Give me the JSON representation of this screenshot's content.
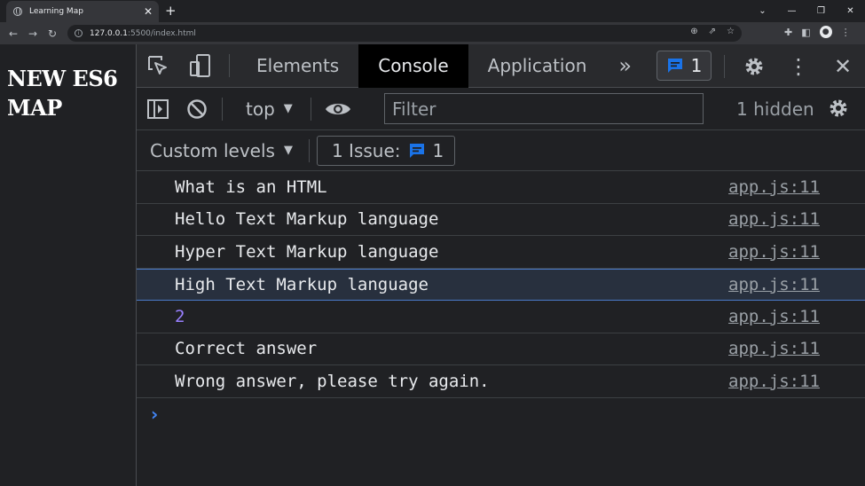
{
  "browser": {
    "tab_title": "Learning Map",
    "new_tab": "+",
    "url_host": "127.0.0.1",
    "url_rest": ":5500/index.html"
  },
  "page": {
    "heading_line1": "NEW ES6",
    "heading_line2": "MAP"
  },
  "devtools": {
    "tabs": [
      {
        "label": "Elements",
        "active": false
      },
      {
        "label": "Console",
        "active": true
      },
      {
        "label": "Application",
        "active": false
      }
    ],
    "issues_badge_count": "1",
    "context": "top",
    "filter_placeholder": "Filter",
    "hidden_count": "1 hidden",
    "levels": "Custom levels",
    "issue_label": "1 Issue:",
    "issue_count": "1",
    "messages": [
      {
        "text": "What is an HTML",
        "source": "app.js:11",
        "type": "string"
      },
      {
        "text": "Hello Text Markup language",
        "source": "app.js:11",
        "type": "string"
      },
      {
        "text": "Hyper Text Markup language",
        "source": "app.js:11",
        "type": "string"
      },
      {
        "text": "High Text Markup language",
        "source": "app.js:11",
        "type": "string"
      },
      {
        "text": "2",
        "source": "app.js:11",
        "type": "number"
      },
      {
        "text": "Correct answer",
        "source": "app.js:11",
        "type": "string"
      },
      {
        "text": "Wrong answer, please try again.",
        "source": "app.js:11",
        "type": "string"
      }
    ],
    "prompt": "›"
  },
  "colors": {
    "accent": "#1a73e8",
    "number": "#9980ff",
    "selected_row": "#28303e"
  }
}
